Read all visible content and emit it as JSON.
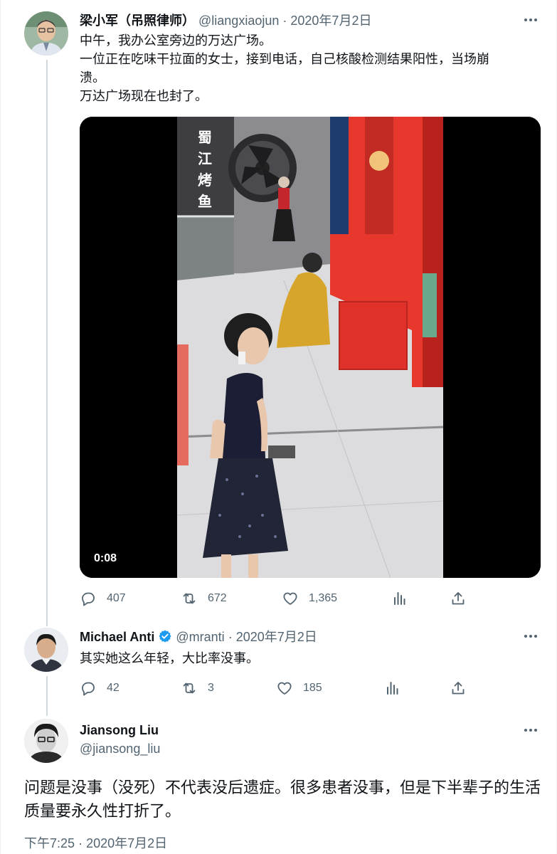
{
  "tweet1": {
    "name": "梁小军（吊照律师）",
    "handle": "@liangxiaojun",
    "sep": "·",
    "date": "2020年7月2日",
    "lines": [
      "中午，我办公室旁边的万达广场。",
      "一位正在吃味干拉面的女士，接到电话，自己核酸检测结果阳性，当场崩",
      "溃。",
      "万达广场现在也封了。"
    ],
    "video": {
      "duration": "0:08",
      "sign_text": [
        "蜀",
        "江",
        "烤",
        "鱼"
      ]
    },
    "actions": {
      "reply": "407",
      "retweet": "672",
      "like": "1,365",
      "views": "",
      "share": ""
    }
  },
  "tweet2": {
    "name": "Michael Anti",
    "handle": "@mranti",
    "sep": "·",
    "date": "2020年7月2日",
    "text": "其实她这么年轻，大比率没事。",
    "actions": {
      "reply": "42",
      "retweet": "3",
      "like": "185"
    }
  },
  "tweet3": {
    "name": "Jiansong Liu",
    "handle": "@jiansong_liu",
    "text_lines": [
      "问题是没事（没死）不代表没后遗症。很多患者没事，但是下半辈子的生活",
      "质量要永久性打折了。"
    ],
    "time": "下午7:25",
    "sep": "·",
    "date": "2020年7月2日"
  },
  "colors": {
    "text": "#0f1419",
    "secondary": "#536471",
    "verified": "#1d9bf0",
    "thread_line": "#cfd9de",
    "red_wall": "#e8372c",
    "dress": "#d7a52c"
  }
}
